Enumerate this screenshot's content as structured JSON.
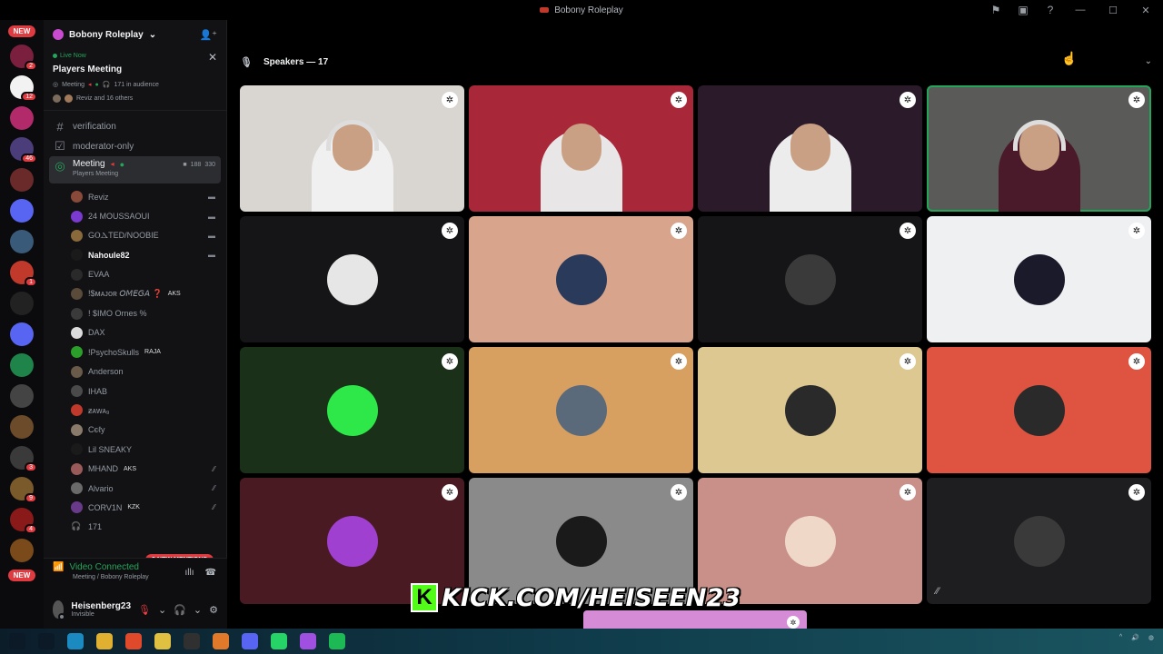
{
  "window": {
    "title": "Bobony Roleplay"
  },
  "servers": {
    "new_top": "NEW",
    "new_bottom": "NEW",
    "items": [
      {
        "color": "#7a1f3d",
        "badge": "2"
      },
      {
        "color": "#f2f2f2",
        "badge": "12"
      },
      {
        "color": "#b22a6a",
        "badge": ""
      },
      {
        "color": "#4a3d7a",
        "badge": "46"
      },
      {
        "color": "#6b2a2a",
        "badge": ""
      },
      {
        "color": "#5865f2",
        "badge": ""
      },
      {
        "color": "#3a5a7a",
        "badge": ""
      },
      {
        "color": "#c0392b",
        "badge": "1"
      },
      {
        "color": "#222",
        "badge": ""
      },
      {
        "color": "#5865f2",
        "badge": ""
      },
      {
        "color": "#1e8449",
        "badge": ""
      },
      {
        "color": "#444",
        "badge": ""
      },
      {
        "color": "#6b4b2a",
        "badge": ""
      },
      {
        "color": "#3a3a3a",
        "badge": "3"
      },
      {
        "color": "#7a5a2a",
        "badge": "9"
      },
      {
        "color": "#8a1a1a",
        "badge": "4"
      },
      {
        "color": "#7a4a1a",
        "badge": ""
      }
    ]
  },
  "sidebar": {
    "server_name": "Bobony Roleplay",
    "live": {
      "label": "Live Now",
      "title": "Players Meeting",
      "meta_channel": "Meeting",
      "audience": "171 in audience",
      "others": "Reviz and 16 others"
    },
    "channels": [
      {
        "name": "verification",
        "icon": "#"
      },
      {
        "name": "moderator-only",
        "icon": "☑"
      }
    ],
    "active_channel": {
      "name": "Meeting",
      "sub": "Players Meeting",
      "count_a": "188",
      "count_b": "330"
    },
    "voice_users": [
      {
        "name": "Reviz",
        "color": "#8a4a3a",
        "icon": "▬",
        "bold": false,
        "tag": ""
      },
      {
        "name": "24 MOUSSAOUI",
        "color": "#7a3ad0",
        "icon": "▬",
        "bold": false,
        "tag": ""
      },
      {
        "name": "GⲞⲆTED/NOOBIE",
        "color": "#8a6a3a",
        "icon": "▬",
        "bold": false,
        "tag": ""
      },
      {
        "name": "Nahoule82",
        "color": "#1a1a1a",
        "icon": "▬",
        "bold": true,
        "tag": ""
      },
      {
        "name": "EVAA",
        "color": "#2a2a2a",
        "icon": "",
        "bold": false,
        "tag": ""
      },
      {
        "name": "!$ᴍᴀᴊᴏʀ 𝘖𝘔𝘌𝘎𝘈 ❓",
        "color": "#5a4a3a",
        "icon": "",
        "bold": false,
        "tag": "AKS"
      },
      {
        "name": "! $IMO Ornes %",
        "color": "#3a3a3a",
        "icon": "",
        "bold": false,
        "tag": ""
      },
      {
        "name": "DAX",
        "color": "#dcdcdc",
        "icon": "",
        "bold": false,
        "tag": ""
      },
      {
        "name": "!PsychoSkulls",
        "color": "#2aa02a",
        "icon": "",
        "bold": false,
        "tag": "RAJA"
      },
      {
        "name": "Anderson",
        "color": "#6a5a4a",
        "icon": "",
        "bold": false,
        "tag": ""
      },
      {
        "name": "IHAB",
        "color": "#4a4a4a",
        "icon": "",
        "bold": false,
        "tag": ""
      },
      {
        "name": "ƶᴀᴡᴀ₉",
        "color": "#c0392b",
        "icon": "",
        "bold": false,
        "tag": ""
      },
      {
        "name": "Cєℓу",
        "color": "#8a7a6a",
        "icon": "",
        "bold": false,
        "tag": ""
      },
      {
        "name": "Lil SNEAKY",
        "color": "#1a1a1a",
        "icon": "",
        "bold": false,
        "tag": ""
      },
      {
        "name": "MHAND",
        "color": "#9a5a5a",
        "icon": "⁄⁄",
        "bold": false,
        "tag": "AKS"
      },
      {
        "name": "Alvario",
        "color": "#6a6a6a",
        "icon": "⁄⁄",
        "bold": false,
        "tag": ""
      },
      {
        "name": "CORV1N",
        "color": "#6a3a8a",
        "icon": "⁄⁄",
        "bold": false,
        "tag": "KZK"
      }
    ],
    "more_count": "171",
    "mentions": "3 NEW MENTIONS",
    "voice_connected": {
      "title": "Video Connected",
      "sub": "Meeting / Bobony Roleplay"
    },
    "user": {
      "name": "Heisenberg23",
      "status": "Invisible"
    }
  },
  "main": {
    "speakers_label": "Speakers — 17",
    "tiles": [
      {
        "kind": "cam",
        "bg": "#d9d6d2",
        "shirt": "#f0f0f0",
        "speaking": false,
        "headset": true
      },
      {
        "kind": "cam",
        "bg": "#a8283a",
        "shirt": "#e8e6e6",
        "speaking": false,
        "headset": false
      },
      {
        "kind": "cam",
        "bg": "#2a1a2a",
        "shirt": "#ececec",
        "speaking": false,
        "headset": false
      },
      {
        "kind": "cam",
        "bg": "#5a5a58",
        "shirt": "#4a1a2a",
        "speaking": true,
        "headset": true
      },
      {
        "kind": "avatar",
        "bg": "#151517",
        "av": "#e6e6e6"
      },
      {
        "kind": "avatar",
        "bg": "#d8a58c",
        "av": "#2a3a5a"
      },
      {
        "kind": "avatar",
        "bg": "#151517",
        "av": "#3a3a3a"
      },
      {
        "kind": "avatar",
        "bg": "#eef0f2",
        "av": "#1a1a2a"
      },
      {
        "kind": "avatar",
        "bg": "#1a3018",
        "av": "#2ee84a"
      },
      {
        "kind": "avatar",
        "bg": "#d8a060",
        "av": "#5a6a7a"
      },
      {
        "kind": "avatar",
        "bg": "#dcc890",
        "av": "#2a2a2a"
      },
      {
        "kind": "avatar",
        "bg": "#de5440",
        "av": "#2a2a2a"
      },
      {
        "kind": "avatar",
        "bg": "#4a1a22",
        "av": "#a040d0"
      },
      {
        "kind": "avatar",
        "bg": "#8a8a8a",
        "av": "#1a1a1a"
      },
      {
        "kind": "avatar",
        "bg": "#c89088",
        "av": "#f0d8c8"
      },
      {
        "kind": "avatar",
        "bg": "#1e1e20",
        "av": "#3a3a3a"
      }
    ],
    "kick_banner": "KICK.COM/HEISEEN23"
  },
  "taskbar": {
    "apps": [
      {
        "name": "start",
        "color": "#0b1a26"
      },
      {
        "name": "search",
        "color": "#0b1a26"
      },
      {
        "name": "edge",
        "color": "#1a8ac0"
      },
      {
        "name": "files",
        "color": "#e0b030"
      },
      {
        "name": "brave",
        "color": "#e04a2a"
      },
      {
        "name": "notepad",
        "color": "#e0c040"
      },
      {
        "name": "obs",
        "color": "#303030"
      },
      {
        "name": "ableton",
        "color": "#e07a2a"
      },
      {
        "name": "discord",
        "color": "#5865f2"
      },
      {
        "name": "whatsapp",
        "color": "#25d366"
      },
      {
        "name": "messenger",
        "color": "#a050e0"
      },
      {
        "name": "spotify",
        "color": "#1db954"
      }
    ]
  },
  "colors": {
    "accent_green": "#23a55a",
    "mention_red": "#e03b40",
    "kick_green": "#53fc18"
  }
}
